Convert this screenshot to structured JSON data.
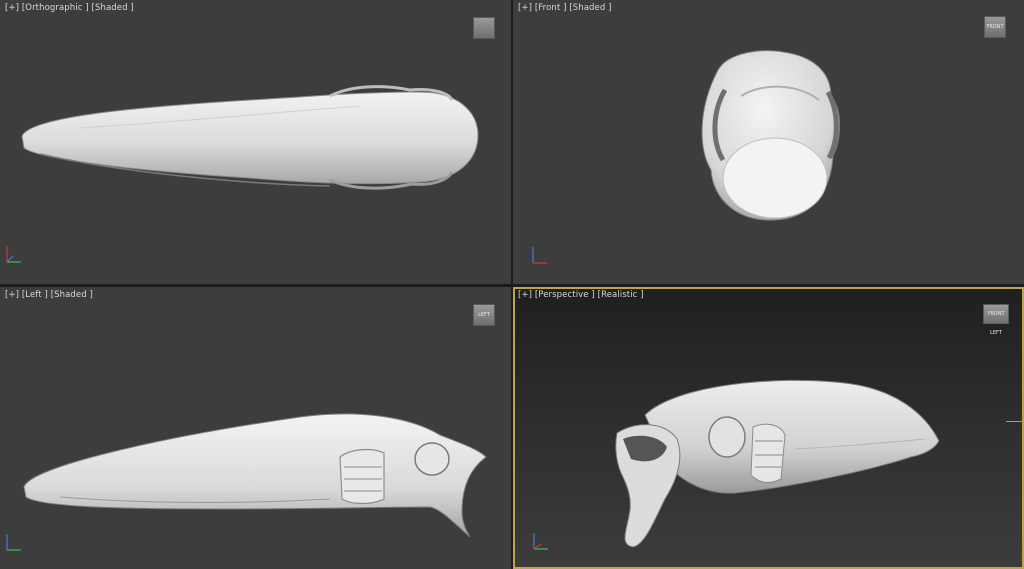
{
  "viewports": {
    "top": {
      "plus": "[+]",
      "view": "[Orthographic ]",
      "mode": "[Shaded ]",
      "cube": ""
    },
    "front": {
      "plus": "[+]",
      "view": "[Front ]",
      "mode": "[Shaded ]",
      "cube": "FRONT"
    },
    "left": {
      "plus": "[+]",
      "view": "[Left ]",
      "mode": "[Shaded ]",
      "cube": "LEFT"
    },
    "perspective": {
      "plus": "[+]",
      "view": "[Perspective ]",
      "mode": "[Realistic ]",
      "cube": "FRONT LEFT"
    }
  },
  "colors": {
    "viewport_bg": "#3d3d3d",
    "active_border": "#c2a24a",
    "model": "#e4e4e4",
    "axis_x": "#d23a3a",
    "axis_y": "#3fbf4a",
    "axis_z": "#4a7ad6"
  },
  "icons": [
    "viewcube-icon",
    "axis-tripod-icon"
  ]
}
